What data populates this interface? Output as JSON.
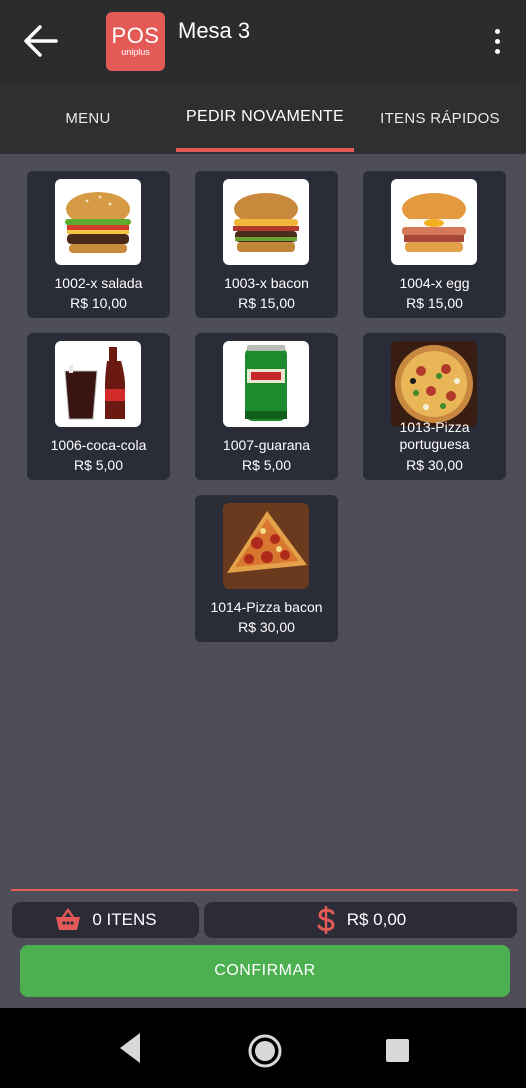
{
  "header": {
    "title": "Mesa 3",
    "logo_main": "POS",
    "logo_sub": "uniplus",
    "back_icon": "arrow-left-icon",
    "menu_icon": "more-vertical-icon"
  },
  "tabs": [
    {
      "label": "MENU",
      "active": false
    },
    {
      "label": "PEDIR NOVAMENTE",
      "active": true
    },
    {
      "label": "ITENS RÁPIDOS",
      "active": false
    }
  ],
  "products": [
    {
      "name": "1002-x salada",
      "price": "R$ 10,00",
      "image": "burger-salad"
    },
    {
      "name": "1003-x bacon",
      "price": "R$ 15,00",
      "image": "burger-bacon"
    },
    {
      "name": "1004-x egg",
      "price": "R$ 15,00",
      "image": "burger-egg"
    },
    {
      "name": "1006-coca-cola",
      "price": "R$ 5,00",
      "image": "coca-cola"
    },
    {
      "name": "1007-guarana",
      "price": "R$ 5,00",
      "image": "guarana-can"
    },
    {
      "name": "1013-Pizza portuguesa",
      "price": "R$ 30,00",
      "image": "pizza-portuguesa"
    },
    {
      "name": "1014-Pizza bacon",
      "price": "R$ 30,00",
      "image": "pizza-bacon"
    }
  ],
  "summary": {
    "items_label": "0 ITENS",
    "total_label": "R$ 0,00",
    "basket_icon": "basket-icon",
    "currency_icon": "dollar-icon"
  },
  "confirm_label": "CONFIRMAR",
  "colors": {
    "accent": "#e35a56",
    "confirm": "#4caf50",
    "background": "#4d4e57",
    "card": "#2a2c38",
    "appbar": "#2b2c2e"
  },
  "system_nav": [
    "nav-back-icon",
    "nav-home-icon",
    "nav-recents-icon"
  ]
}
